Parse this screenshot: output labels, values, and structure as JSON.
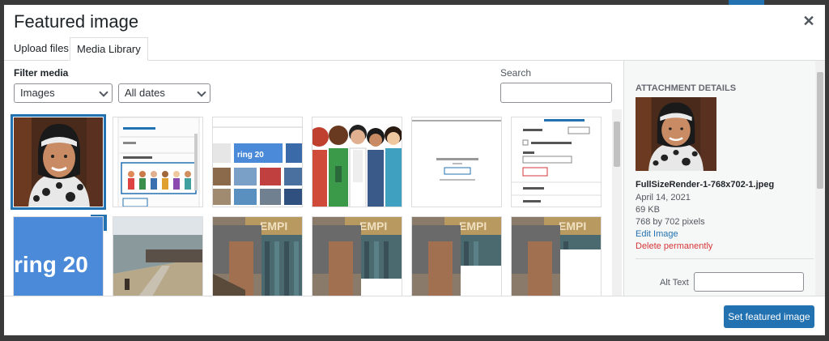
{
  "modal": {
    "title": "Featured image"
  },
  "tabs": [
    {
      "label": "Upload files"
    },
    {
      "label": "Media Library"
    }
  ],
  "filters": {
    "label": "Filter media",
    "type_value": "Images",
    "date_value": "All dates"
  },
  "search": {
    "label": "Search",
    "value": ""
  },
  "grid": {
    "items": [
      {
        "icon": "portrait-thumbnail",
        "selected": true
      },
      {
        "icon": "editor-screenshot-thumbnail"
      },
      {
        "icon": "blog-screenshot-thumbnail"
      },
      {
        "icon": "cartoon-people-thumbnail"
      },
      {
        "icon": "upload-screenshot-thumbnail"
      },
      {
        "icon": "post-settings-thumbnail"
      },
      {
        "icon": "spring-banner-thumbnail"
      },
      {
        "icon": "border-wall-photo-thumbnail"
      },
      {
        "icon": "painted-wall-thumbnail"
      },
      {
        "icon": "painted-wall-thumbnail"
      },
      {
        "icon": "painted-wall-thumbnail"
      },
      {
        "icon": "painted-wall-thumbnail"
      }
    ]
  },
  "attachment": {
    "heading": "ATTACHMENT DETAILS",
    "filename": "FullSizeRender-1-768x702-1.jpeg",
    "date": "April 14, 2021",
    "size": "69 KB",
    "dimensions": "768 by 702 pixels",
    "edit_label": "Edit Image",
    "delete_label": "Delete permanently",
    "alt_label": "Alt Text",
    "alt_value": ""
  },
  "footer": {
    "button_label": "Set featured image"
  },
  "colors": {
    "accent": "#2271b1",
    "danger": "#d63638"
  }
}
